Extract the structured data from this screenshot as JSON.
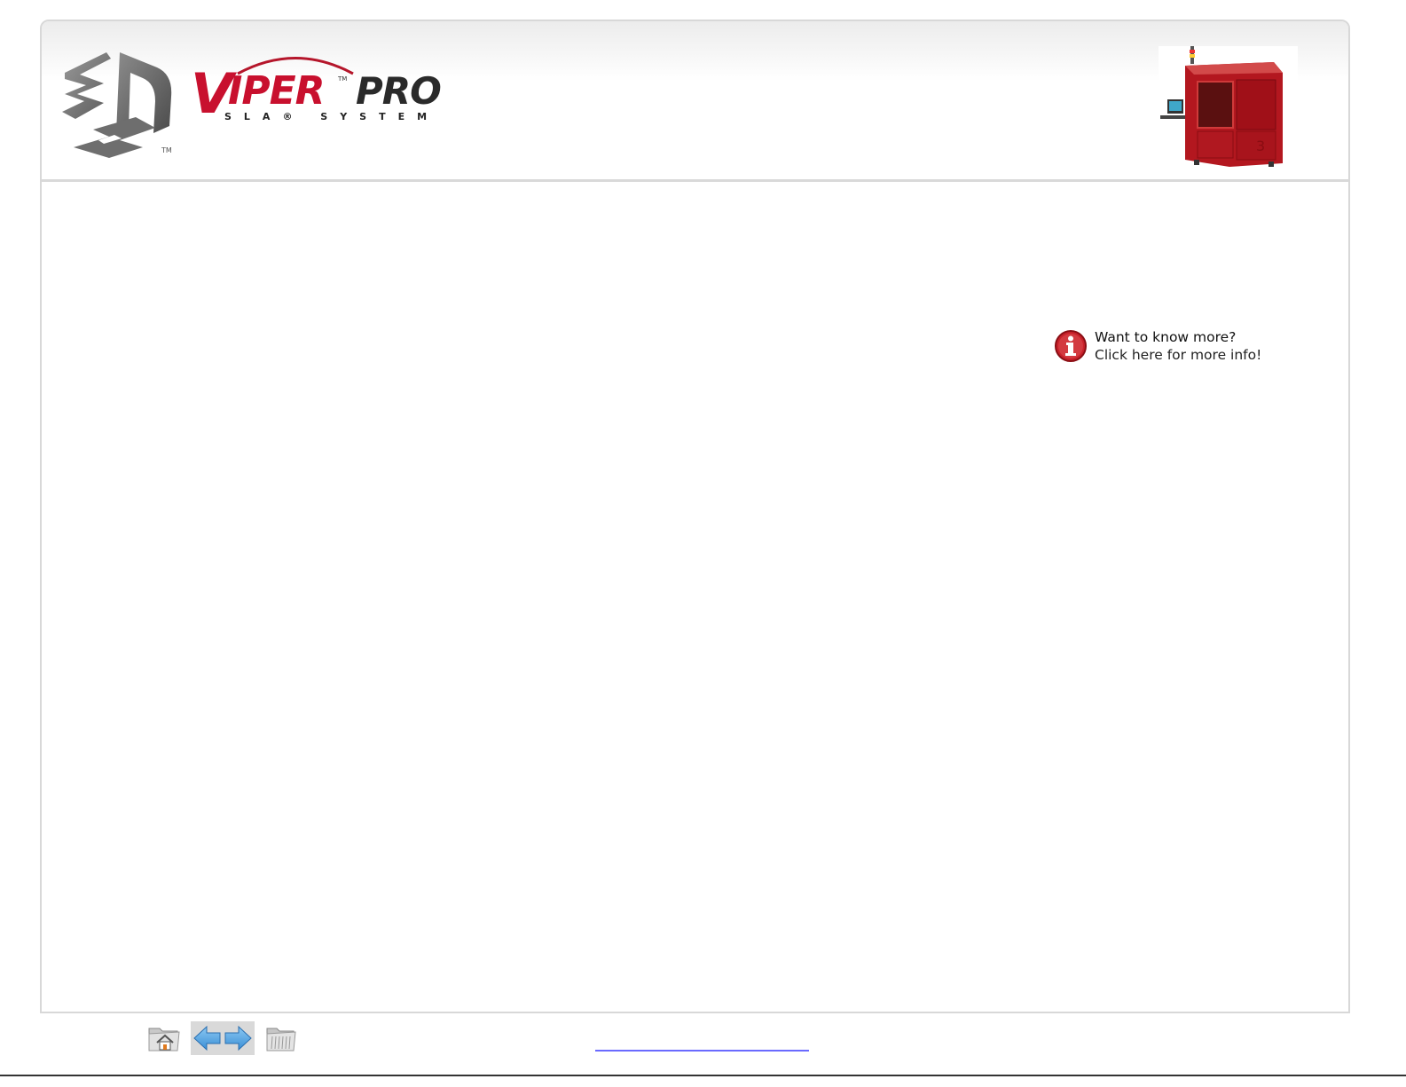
{
  "header": {
    "brand_logo_text": "3D",
    "brand_tm": "TM",
    "product_logo_main": "VIPER",
    "product_logo_tm": "TM",
    "product_logo_pro": "PRO",
    "product_logo_sub": "SLA® SYSTEM",
    "machine_image": "Viper Pro machine photo"
  },
  "info_callout": {
    "line1": "Want to know more?",
    "line2": "Click here for more info!",
    "icon": "info-icon"
  },
  "nav": {
    "home_icon": "home-folder-icon",
    "back_icon": "arrow-left-icon",
    "forward_icon": "arrow-right-icon",
    "index_icon": "folder-icon"
  },
  "colors": {
    "brand_red": "#c8102e",
    "arrow_blue": "#4a9de0",
    "frame_border": "#d8d8d8",
    "link_blue": "#6a6aff"
  }
}
